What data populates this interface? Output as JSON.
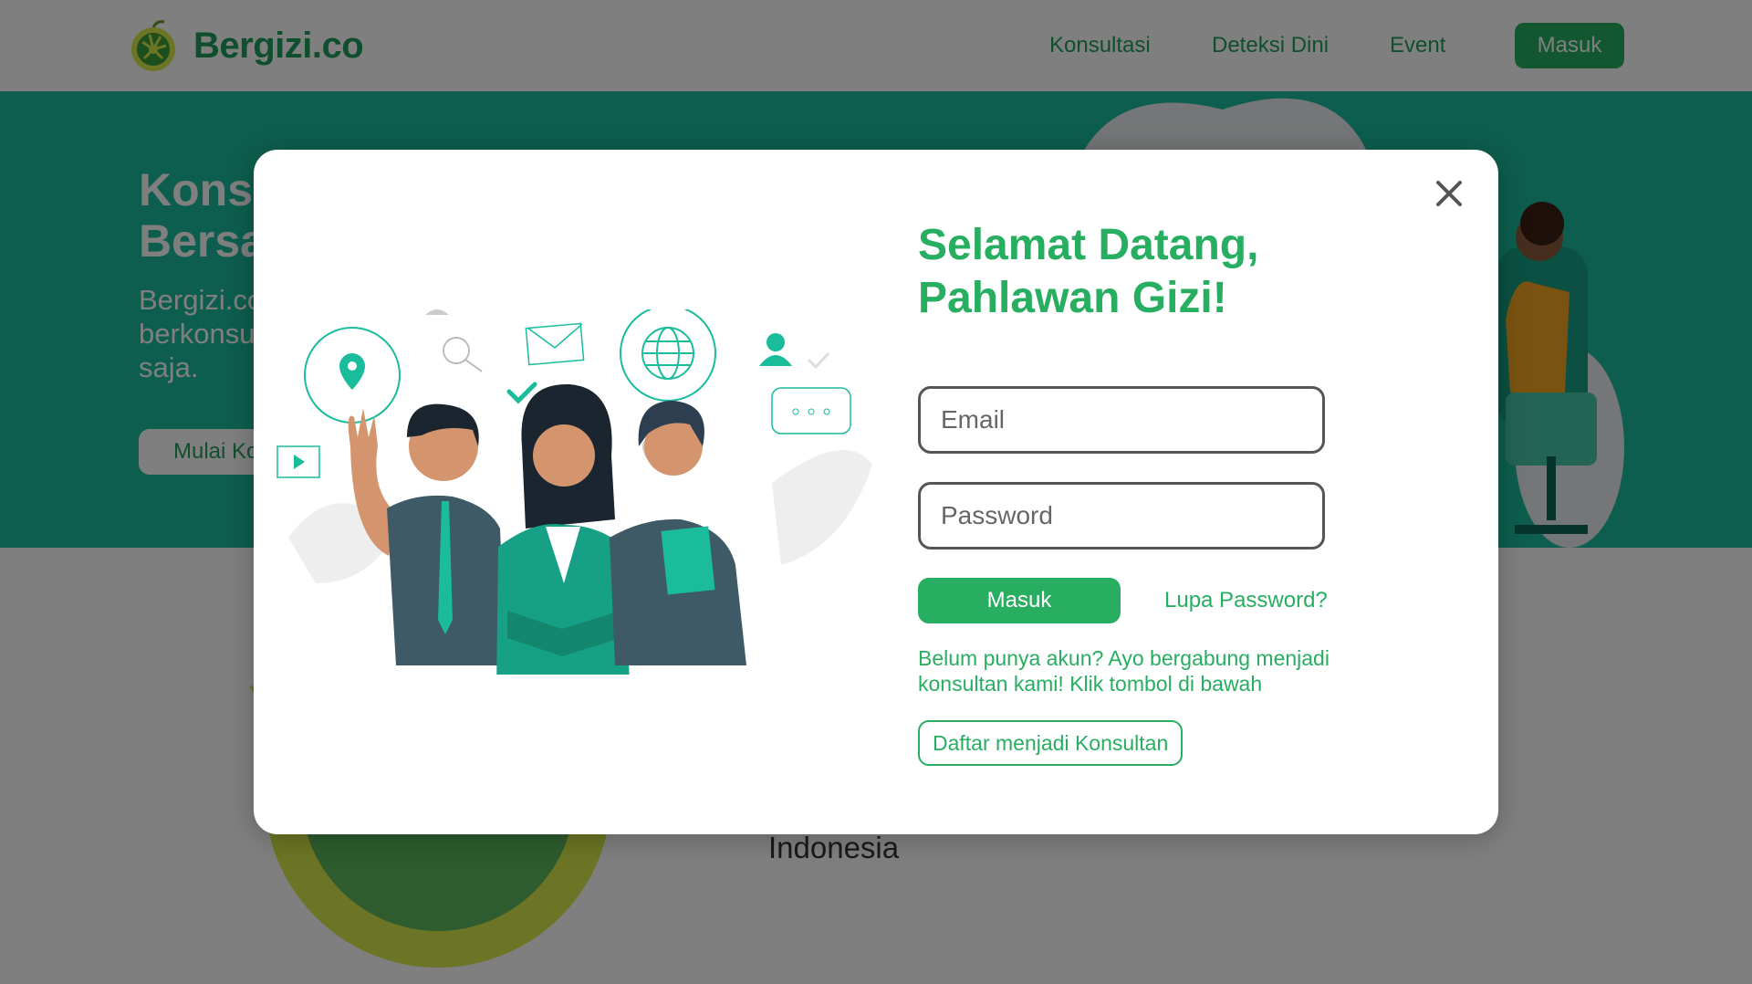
{
  "brand": {
    "name": "Bergizi.co",
    "color": "#1e9e5a",
    "logo_icon": "lime-fruit-logo"
  },
  "nav": {
    "links": [
      "Konsultasi",
      "Deteksi Dini",
      "Event"
    ],
    "login_label": "Masuk"
  },
  "hero": {
    "title_lines": [
      "Konsu",
      "Bersa"
    ],
    "description_lines": [
      "Bergizi.co",
      "berkonsu",
      "saja."
    ],
    "cta_label": "Mulai Ko",
    "background": "#1abc9c"
  },
  "lower_section": {
    "text": "Indonesia"
  },
  "modal": {
    "title": "Selamat Datang, Pahlawan Gizi!",
    "email_placeholder": "Email",
    "password_placeholder": "Password",
    "login_label": "Masuk",
    "forgot_label": "Lupa Password?",
    "signup_text": "Belum punya akun? Ayo bergabung menjadi konsultan kami! Klik tombol di bawah",
    "register_label": "Daftar menjadi Konsultan",
    "close_icon": "close-icon",
    "accent": "#27ae60"
  }
}
